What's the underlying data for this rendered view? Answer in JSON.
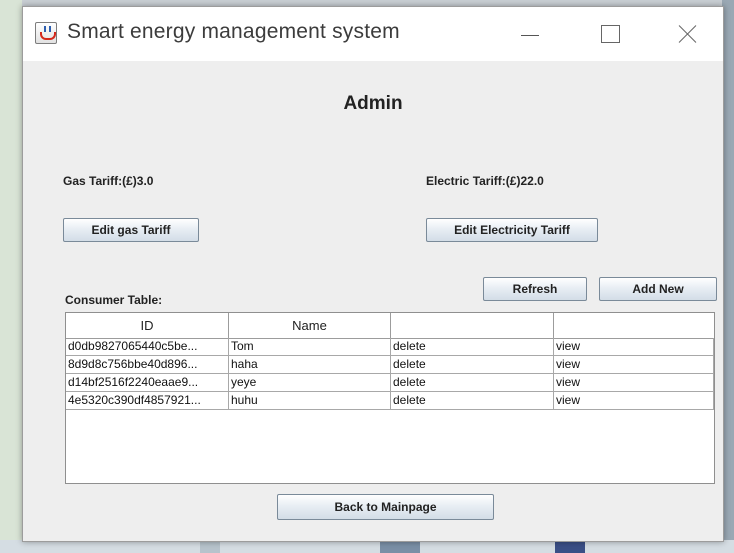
{
  "window": {
    "title": "Smart energy management system"
  },
  "page": {
    "heading": "Admin",
    "gas_tariff_label": "Gas Tariff:(£)3.0",
    "electric_tariff_label": "Electric Tariff:(£)22.0",
    "edit_gas_button": "Edit gas Tariff",
    "edit_electricity_button": "Edit Electricity Tariff",
    "consumer_table_label": "Consumer Table:",
    "refresh_button": "Refresh",
    "add_new_button": "Add New",
    "back_button": "Back to Mainpage"
  },
  "table": {
    "headers": [
      "ID",
      "Name",
      "",
      ""
    ],
    "rows": [
      {
        "id": "d0db9827065440c5be...",
        "name": "Tom",
        "action1": "delete",
        "action2": "view"
      },
      {
        "id": "8d9d8c756bbe40d896...",
        "name": "haha",
        "action1": "delete",
        "action2": "view"
      },
      {
        "id": "d14bf2516f2240eaae9...",
        "name": "yeye",
        "action1": "delete",
        "action2": "view"
      },
      {
        "id": "4e5320c390df4857921...",
        "name": "huhu",
        "action1": "delete",
        "action2": "view"
      }
    ]
  },
  "icons": {
    "app": "java-cup-icon",
    "minimize": "minimize-icon",
    "maximize": "maximize-icon",
    "close": "close-icon"
  },
  "colors": {
    "window_bg": "#eeeeee",
    "titlebar_bg": "#ffffff",
    "button_border": "#7a8a99"
  }
}
